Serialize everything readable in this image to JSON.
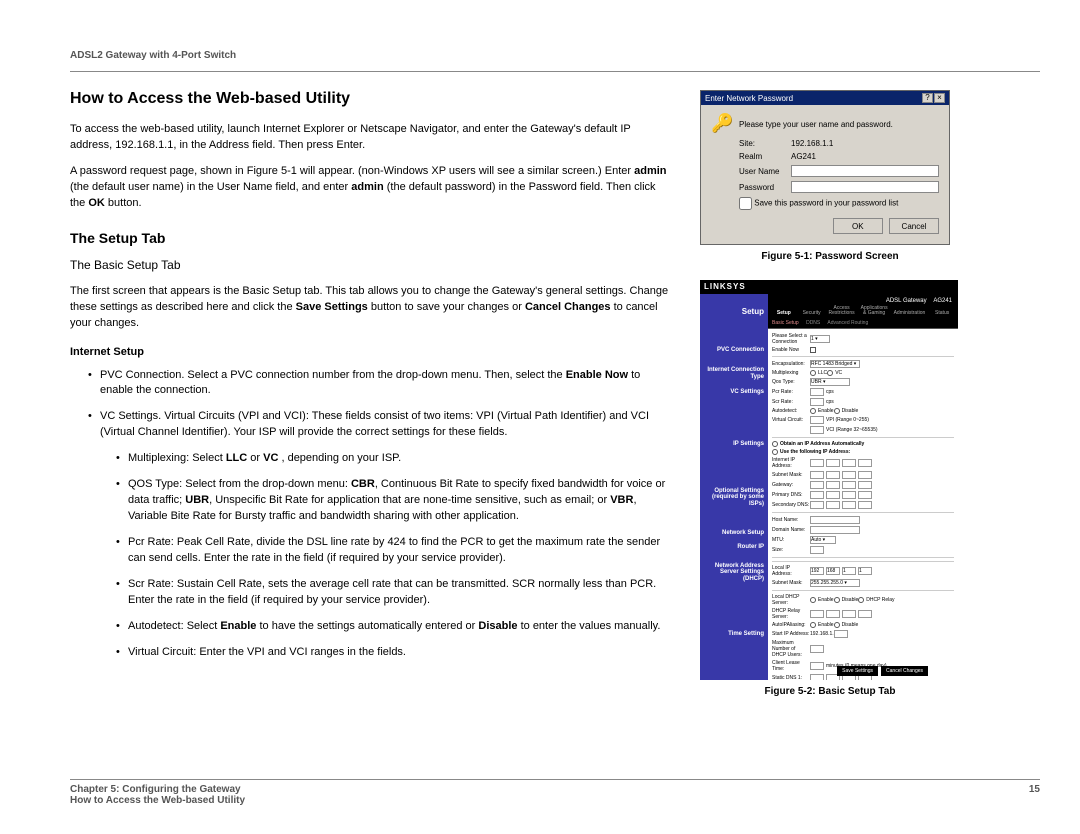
{
  "product": "ADSL2 Gateway with 4-Port Switch",
  "h1": "How to Access the Web-based Utility",
  "p1": "To access the web-based utility, launch Internet Explorer or Netscape Navigator, and enter the Gateway's default IP address, 192.168.1.1, in the Address field. Then press Enter.",
  "p2a": "A password request page, shown in Figure 5-1 will appear. (non-Windows XP users will see a similar screen.) Enter ",
  "p2b": "admin",
  "p2c": " (the default user name) in the User Name field, and enter ",
  "p2d": "admin",
  "p2e": " (the default password) in the Password field.  Then click the ",
  "p2f": "OK",
  "p2g": " button.",
  "h2": "The Setup Tab",
  "h3": "The Basic Setup Tab",
  "p3a": "The first screen that appears is the Basic Setup tab. This tab allows you to change the Gateway's general settings. Change these settings as described here and click the ",
  "p3b": "Save Settings",
  "p3c": " button to save your changes or ",
  "p3d": "Cancel Changes",
  "p3e": " to cancel your changes.",
  "h4": "Internet Setup",
  "li1a": "PVC Connection. Select a PVC connection number from the drop-down menu. Then, select the ",
  "li1b": "Enable Now",
  "li1c": " to enable the connection.",
  "li2": "VC Settings. Virtual Circuits (VPI and VCI): These fields consist of two items: VPI (Virtual Path Identifier) and VCI (Virtual Channel Identifier). Your ISP will provide the correct settings for these fields.",
  "li2_1a": "Multiplexing: Select ",
  "li2_1b": "LLC",
  "li2_1c": " or ",
  "li2_1d": "VC",
  "li2_1e": " , depending on your ISP.",
  "li2_2a": "QOS Type: Select from the drop-down menu: ",
  "li2_2b": "CBR",
  "li2_2c": ", Continuous Bit Rate to specify fixed bandwidth for voice or data traffic; ",
  "li2_2d": "UBR",
  "li2_2e": ", Unspecific Bit Rate for application that are none-time sensitive, such as email; or ",
  "li2_2f": "VBR",
  "li2_2g": ", Variable Bite Rate for Bursty traffic and bandwidth sharing with other application.",
  "li2_3": "Pcr Rate: Peak Cell Rate, divide the DSL line rate by 424 to find the PCR to get the maximum rate the sender can send cells. Enter the rate in the field (if required by your service provider).",
  "li2_4": "Scr Rate: Sustain Cell Rate, sets the average cell rate that can be transmitted. SCR normally less than PCR. Enter the rate in the field (if required by your service provider).",
  "li2_5a": "Autodetect: Select ",
  "li2_5b": "Enable",
  "li2_5c": " to have the settings automatically entered or ",
  "li2_5d": "Disable",
  "li2_5e": " to enter the values manually.",
  "li2_6": "Virtual Circuit: Enter the VPI and VCI ranges in the fields.",
  "fig1_caption": "Figure 5-1: Password Screen",
  "fig2_caption": "Figure 5-2: Basic Setup Tab",
  "dialog": {
    "title": "Enter Network Password",
    "prompt": "Please type your user name and password.",
    "site_label": "Site:",
    "site_value": "192.168.1.1",
    "realm_label": "Realm",
    "realm_value": "AG241",
    "user_label": "User Name",
    "pass_label": "Password",
    "save_label": "Save this password in your password list",
    "ok": "OK",
    "cancel": "Cancel"
  },
  "router": {
    "logo": "LINKSYS",
    "model": "ADSL Gateway",
    "code": "AG241",
    "left": [
      "Setup",
      "PVC Connection",
      "Internet Connection Type",
      "VC Settings",
      "IP Settings",
      "Optional Settings (required by some ISPs)",
      "Network Setup",
      "Router IP",
      "Network Address Server Settings (DHCP)",
      "Time Setting"
    ],
    "tabs": [
      "Setup",
      "Security",
      "Access Restrictions",
      "Applications & Gaming",
      "Administration",
      "Status"
    ],
    "subtabs": [
      "Basic Setup",
      "DDNS",
      "Advanced Routing"
    ],
    "save": "Save Settings",
    "cancel": "Cancel Changes"
  },
  "footer": {
    "chapter": "Chapter 5: Configuring the Gateway",
    "section": "How to Access the Web-based Utility",
    "page": "15"
  }
}
